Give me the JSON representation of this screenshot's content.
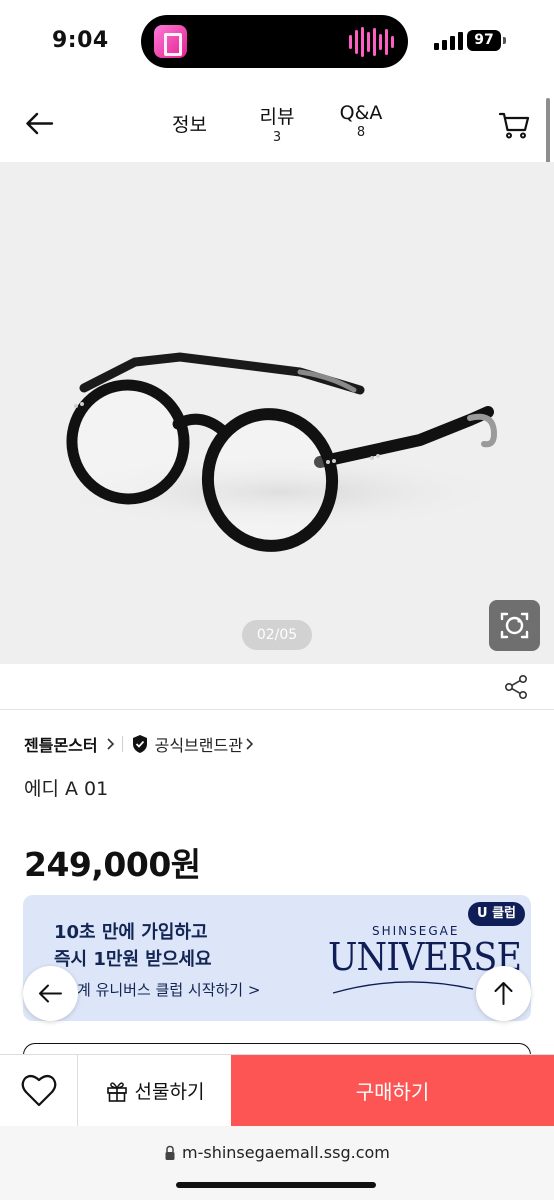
{
  "status_bar": {
    "time": "9:04",
    "battery": "97",
    "signal_icon": "cellular-signal-icon",
    "battery_icon": "battery-icon"
  },
  "header": {
    "back_icon": "arrow-left-icon",
    "tabs": [
      {
        "label": "정보",
        "count": ""
      },
      {
        "label": "리뷰",
        "count": "3"
      },
      {
        "label": "Q&A",
        "count": "8"
      }
    ],
    "cart_icon": "shopping-cart-icon"
  },
  "gallery": {
    "counter": "02/05",
    "current": 2,
    "total": 5,
    "lens_icon": "visual-search-camera-icon"
  },
  "share_icon": "share-icon",
  "product": {
    "brand": "젠틀몬스터",
    "official_store": "공식브랜드관",
    "name": "에디 A 01",
    "price": "249,000원"
  },
  "banner": {
    "line1": "10초 만에 가입하고",
    "line2": "즉시 1만원 받으세요",
    "cta": "계 유니버스 클럽 시작하기 >",
    "badge": "U 클럽",
    "brand_small": "SHINSEGAE",
    "brand_logo": "UNIVERSE",
    "background": "#dde6f8",
    "text_color": "#122554"
  },
  "floating": {
    "back_icon": "arrow-left-icon",
    "top_icon": "arrow-up-icon"
  },
  "action_bar": {
    "wish_icon": "heart-icon",
    "gift_label": "선물하기",
    "gift_icon": "gift-icon",
    "buy_label": "구매하기",
    "buy_color": "#fd5554"
  },
  "browser": {
    "url": "m-shinsegaemall.ssg.com"
  }
}
